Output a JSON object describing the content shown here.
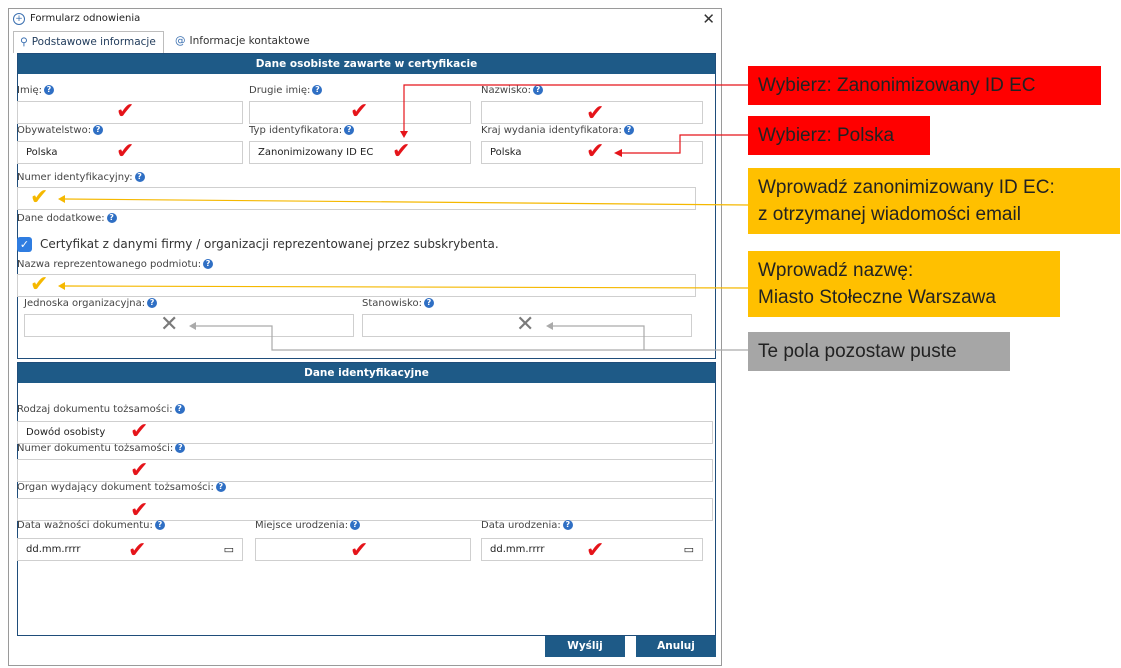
{
  "window": {
    "title": "Formularz odnowienia",
    "close": "✕"
  },
  "tabs": [
    {
      "label": "Podstawowe informacje",
      "icon": "person-icon",
      "active": true
    },
    {
      "label": "Informacje kontaktowe",
      "icon": "at-icon",
      "active": false
    }
  ],
  "section1": {
    "header": "Dane osobiste zawarte w certyfikacie",
    "fields": {
      "first_name": {
        "label": "Imię:",
        "value": ""
      },
      "middle_name": {
        "label": "Drugie imię:",
        "value": ""
      },
      "last_name": {
        "label": "Nazwisko:",
        "value": ""
      },
      "citizenship": {
        "label": "Obywatelstwo:",
        "value": "Polska"
      },
      "id_type": {
        "label": "Typ identyfikatora:",
        "value": "Zanonimizowany ID EC"
      },
      "id_country": {
        "label": "Kraj wydania identyfikatora:",
        "value": "Polska"
      },
      "id_number": {
        "label": "Numer identyfikacyjny:",
        "value": ""
      },
      "extra": {
        "label": "Dane dodatkowe:"
      },
      "org_checkbox": {
        "label": "Certyfikat z danymi firmy / organizacji reprezentowanej przez subskrybenta.",
        "checked": true
      },
      "entity_name": {
        "label": "Nazwa reprezentowanego podmiotu:",
        "value": ""
      },
      "org_unit": {
        "label": "Jednoska organizacyjna:",
        "value": ""
      },
      "position": {
        "label": "Stanowisko:",
        "value": ""
      }
    }
  },
  "section2": {
    "header": "Dane identyfikacyjne",
    "fields": {
      "doc_type": {
        "label": "Rodzaj dokumentu tożsamości:",
        "value": "Dowód osobisty"
      },
      "doc_number": {
        "label": "Numer dokumentu tożsamości:",
        "value": ""
      },
      "doc_issuer": {
        "label": "Organ wydający dokument tożsamości:",
        "value": ""
      },
      "doc_expiry": {
        "label": "Data ważności dokumentu:",
        "value": "dd.mm.rrrr"
      },
      "birth_place": {
        "label": "Miejsce urodzenia:",
        "value": ""
      },
      "birth_date": {
        "label": "Data urodzenia:",
        "value": "dd.mm.rrrr"
      }
    }
  },
  "buttons": {
    "send": "Wyślij",
    "cancel": "Anuluj"
  },
  "annotations": {
    "id_type": "Wybierz: Zanonimizowany ID EC",
    "country": "Wybierz: Polska",
    "id_number_line1": "Wprowadź zanonimizowany ID EC:",
    "id_number_line2": "z otrzymanej wiadomości email",
    "entity_line1": "Wprowadź nazwę:",
    "entity_line2": "Miasto Stołeczne Warszawa",
    "empty": "Te pola pozostaw puste"
  },
  "colors": {
    "header": "#1e5a87",
    "red_callout": "#ff0000",
    "yellow_callout": "#ffc000",
    "gray_callout": "#a6a6a6"
  }
}
